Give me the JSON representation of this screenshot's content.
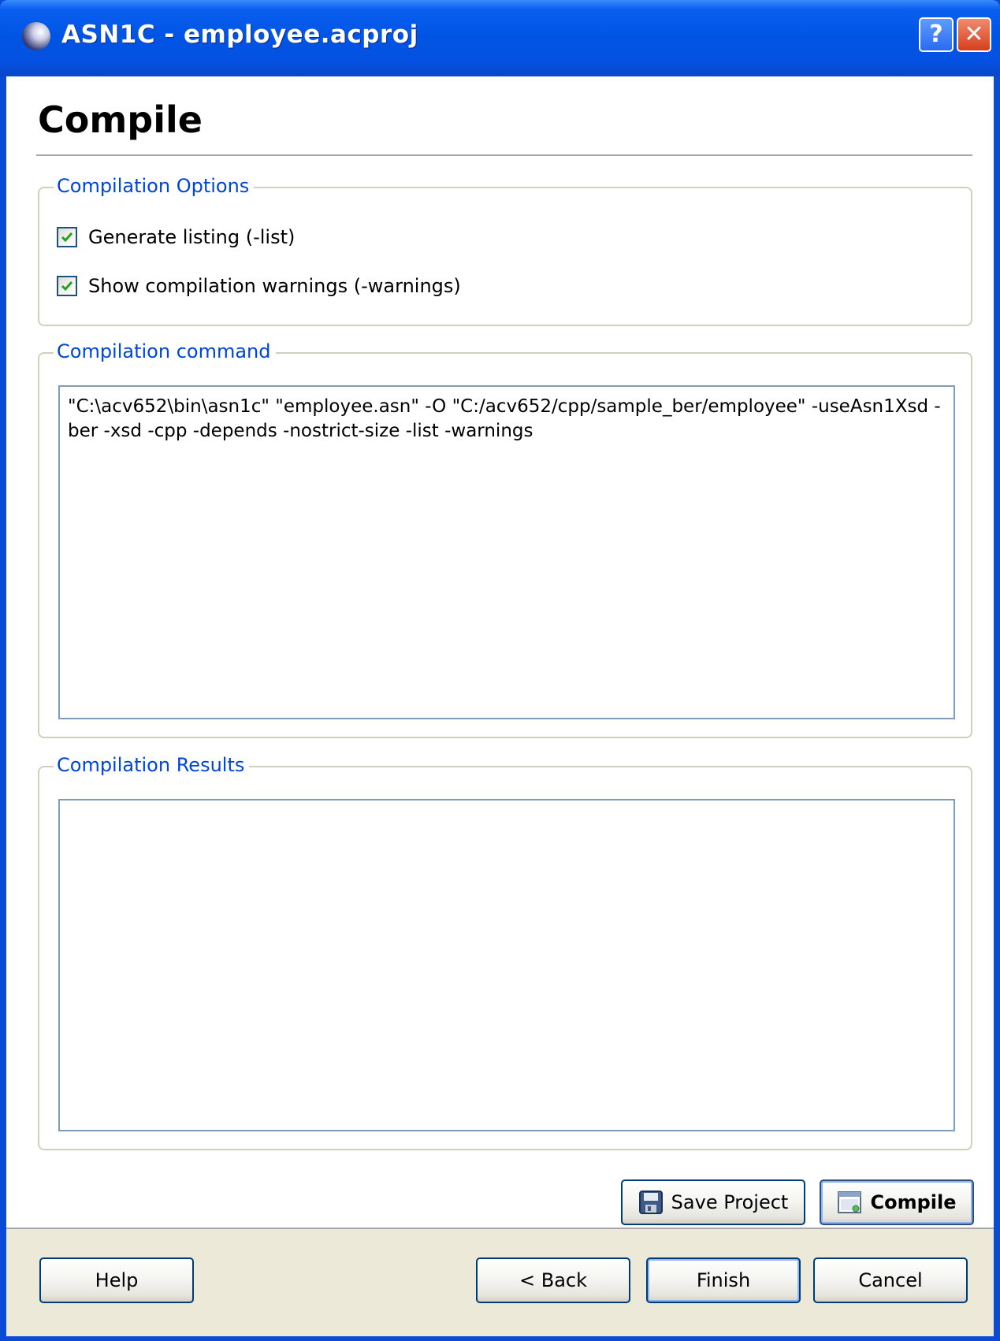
{
  "window": {
    "title": "ASN1C - employee.acproj",
    "help_glyph": "?",
    "close_glyph": "✕"
  },
  "page": {
    "title": "Compile"
  },
  "options": {
    "legend": "Compilation Options",
    "items": [
      {
        "label": "Generate listing (-list)",
        "checked": true
      },
      {
        "label": "Show compilation warnings (-warnings)",
        "checked": true
      }
    ]
  },
  "command": {
    "legend": "Compilation command",
    "value": "\"C:\\acv652\\bin\\asn1c\" \"employee.asn\" -O \"C:/acv652/cpp/sample_ber/employee\" -useAsn1Xsd -ber -xsd -cpp -depends -nostrict-size -list -warnings"
  },
  "results": {
    "legend": "Compilation Results",
    "value": ""
  },
  "actions": {
    "save_label": "Save Project",
    "compile_label": "Compile"
  },
  "footer": {
    "help_label": "Help",
    "back_label": "< Back",
    "finish_label": "Finish",
    "cancel_label": "Cancel"
  },
  "icons": {
    "app": "globe-icon",
    "save": "floppy-disk-icon",
    "compile": "compile-window-icon",
    "check": "checkmark-icon"
  },
  "colors": {
    "titlebar": "#0054e3",
    "legend_text": "#0046d5",
    "footer_bg": "#ece9d8",
    "check_color": "#21a121"
  }
}
